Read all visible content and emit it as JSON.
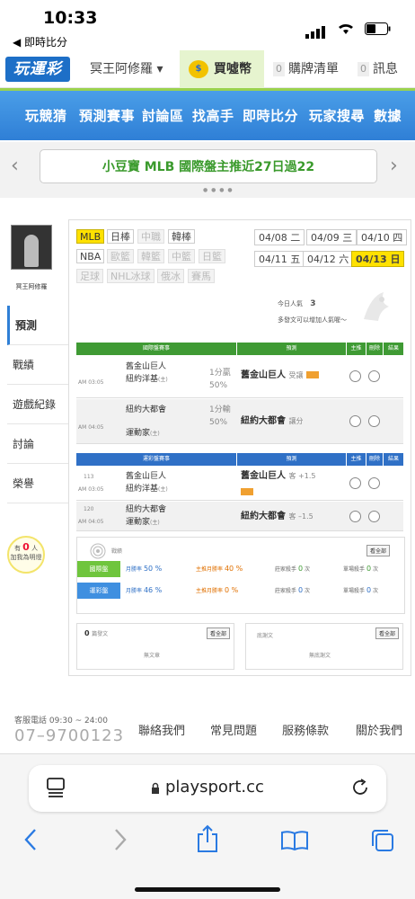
{
  "status": {
    "time": "10:33",
    "back_label": "◀ 即時比分"
  },
  "topbar": {
    "logo": "玩運彩",
    "user_menu": "冥王阿修羅 ▾",
    "coin_icon_text": "$",
    "buy_coin": "買噓幣",
    "cart_count": "0",
    "cart_label": "購牌清單",
    "msg_count": "0",
    "msg_label": "訊息"
  },
  "nav": {
    "items": [
      "玩競猜",
      "預測賽事",
      "討論區",
      "找高手",
      "即時比分",
      "玩家搜尋",
      "數據"
    ]
  },
  "banner": {
    "text": "小豆寶 MLB 國際盤主推近27日過22",
    "prev": "‹",
    "next": "›",
    "dots": "● ● ● ●"
  },
  "sidebar": {
    "username": "冥王阿修羅",
    "items": [
      "預測",
      "戰績",
      "遊戲紀錄",
      "討論",
      "榮譽"
    ],
    "bulb_prefix": "有",
    "bulb_count": "0",
    "bulb_unit": "人",
    "bulb_label": "加我為明燈"
  },
  "leagues": {
    "row1": [
      "MLB",
      "日棒",
      "中職",
      "韓棒"
    ],
    "row2": [
      "NBA",
      "歐籃",
      "韓籃",
      "中籃",
      "日籃"
    ],
    "row3": [
      "足球",
      "NHL冰球",
      "俄冰",
      "賽馬"
    ]
  },
  "dates": [
    "04/08 二",
    "04/09 三",
    "04/10 四",
    "04/11 五",
    "04/12 六",
    "04/13 日"
  ],
  "popularity": {
    "label": "今日人氣",
    "value": "3",
    "hint": "多發文可以增加人氣喔～"
  },
  "intl_table": {
    "headers": [
      "國際盤賽事",
      "預測",
      "主推",
      "刪除",
      "結果"
    ],
    "rows": [
      {
        "time": "AM 03:05",
        "team1": "舊金山巨人",
        "team2": "紐約洋基",
        "sfx2": "(主)",
        "line1": "1分贏",
        "line2": "50%",
        "pick": "舊金山巨人",
        "pick_note": "受讓"
      },
      {
        "time": "AM 04:05",
        "team1": "紐約大都會",
        "team2": "運動家",
        "sfx2": "(主)",
        "line1": "1分輸",
        "line2": "50%",
        "pick": "紐約大都會",
        "pick_note": "讓分"
      }
    ]
  },
  "sports_table": {
    "headers": [
      "運彩盤賽事",
      "預測",
      "主推",
      "刪除",
      "結果"
    ],
    "rows": [
      {
        "num": "113",
        "time": "AM 03:05",
        "team1": "舊金山巨人",
        "team2": "紐約洋基",
        "sfx2": "(主)",
        "pick": "舊金山巨人",
        "pick_note": "客 +1.5"
      },
      {
        "num": "120",
        "time": "AM 04:05",
        "team1": "紐約大都會",
        "team2": "運動家",
        "sfx2": "(主)",
        "pick": "紐約大都會",
        "pick_note": "客 –1.5"
      }
    ]
  },
  "record": {
    "title": "戰績",
    "view_all": "看全部",
    "rows": [
      {
        "label": "國際盤",
        "win_label": "月勝率",
        "win": "50 %",
        "main_label": "主推月勝率",
        "main": "40 %",
        "fav_label": "莊家殺手",
        "fav": "0",
        "fav_unit": "次",
        "single_label": "單場殺手",
        "single": "0",
        "single_unit": "次"
      },
      {
        "label": "運彩盤",
        "win_label": "月勝率",
        "win": "46 %",
        "main_label": "主推月勝率",
        "main": "0 %",
        "fav_label": "莊家殺手",
        "fav": "0",
        "fav_unit": "次",
        "single_label": "單場殺手",
        "single": "0",
        "single_unit": "次"
      }
    ]
  },
  "posts": {
    "left_count": "0",
    "left_label": "篇發文",
    "left_view": "看全部",
    "left_empty": "無文章",
    "right_label": "底謝文",
    "right_view": "看全部",
    "right_empty": "無底謝文"
  },
  "footer": {
    "service_label": "客服電話 09:30 ~ 24:00",
    "phone": "07–9700123",
    "links": [
      "聯絡我們",
      "常見問題",
      "服務條款",
      "關於我們"
    ]
  },
  "browser": {
    "url": "playsport.cc"
  },
  "colors": {
    "green": "#3f9a34",
    "blue": "#2f70c6",
    "yellow": "#ffe100",
    "red": "#e13"
  }
}
